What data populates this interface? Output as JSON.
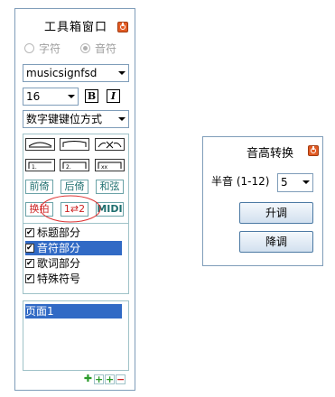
{
  "toolbox": {
    "title": "工具箱窗口",
    "radio_options": [
      {
        "label": "字符",
        "selected": false
      },
      {
        "label": "音符",
        "selected": true
      }
    ],
    "font_select": "musicsignfsd",
    "size_select": "16",
    "bold_label": "B",
    "italic_label": "I",
    "input_mode_select": "数字键键位方式",
    "buttons_row1": [
      "前倚",
      "后倚",
      "和弦"
    ],
    "buttons_row2": [
      "换拍",
      "1⇄2",
      "MIDI"
    ],
    "sections": [
      {
        "label": "标题部分",
        "checked": true,
        "selected": false
      },
      {
        "label": "音符部分",
        "checked": true,
        "selected": true
      },
      {
        "label": "歌词部分",
        "checked": true,
        "selected": false
      },
      {
        "label": "特殊符号",
        "checked": true,
        "selected": false
      }
    ],
    "pages": [
      "页面1"
    ],
    "icons": [
      "close-icon",
      "add-icon",
      "add-page-icon",
      "remove-page-icon"
    ],
    "colors": {
      "close": "#e25b24",
      "selection": "#316ac5",
      "red_text": "#cc2222",
      "teal_text": "#1f6f6f"
    }
  },
  "pitch_dialog": {
    "title": "音高转换",
    "semitone_label": "半音 (1-12)",
    "semitone_value": "5",
    "raise_label": "升调",
    "lower_label": "降调"
  }
}
